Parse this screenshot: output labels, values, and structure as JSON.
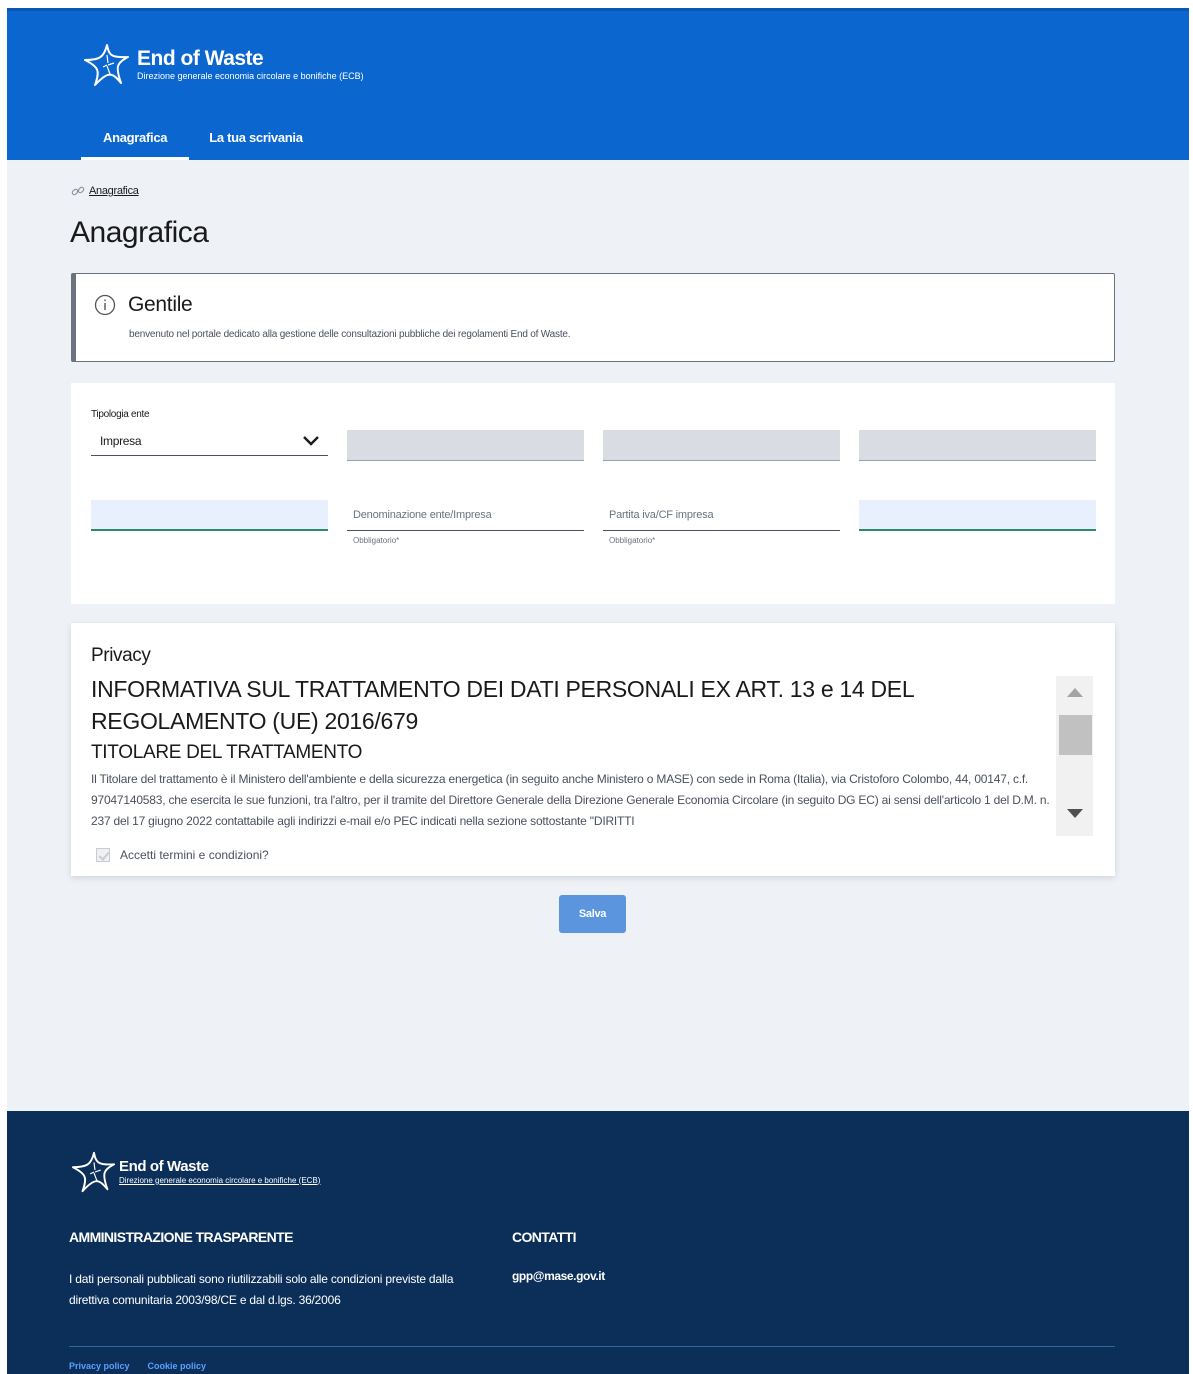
{
  "header": {
    "title": "End of Waste",
    "subtitle": "Direzione generale economia circolare e bonifiche (ECB)",
    "nav": [
      {
        "label": "Anagrafica"
      },
      {
        "label": "La tua scrivania"
      }
    ],
    "color": "#0b66d0"
  },
  "breadcrumb": {
    "icon": "link-icon",
    "label": "Anagrafica"
  },
  "page_title": "Anagrafica",
  "callout": {
    "icon": "info-icon",
    "title": "Gentile",
    "text": "benvenuto nel portale dedicato alla gestione delle consultazioni pubbliche dei regolamenti End of Waste."
  },
  "form": {
    "tipologia": {
      "label": "Tipologia ente",
      "value": "Impresa",
      "icon": "chevron-down-icon"
    },
    "denominazione": {
      "placeholder": "Denominazione ente/Impresa",
      "helper": "Obbligatorio*"
    },
    "partita_iva": {
      "placeholder": "Partita iva/CF impresa",
      "helper": "Obbligatorio*"
    }
  },
  "privacy": {
    "title": "Privacy",
    "heading": "INFORMATIVA SUL TRATTAMENTO DEI DATI PERSONALI EX ART. 13 e 14 DEL REGOLAMENTO (UE) 2016/679",
    "subheading": "TITOLARE DEL TRATTAMENTO",
    "text": "Il Titolare del trattamento è il Ministero dell'ambiente e della sicurezza energetica (in seguito anche Ministero o MASE) con sede in Roma (Italia), via Cristoforo Colombo, 44, 00147, c.f. 97047140583, che esercita le sue funzioni, tra l'altro, per il tramite del Direttore Generale della Direzione Generale Economia Circolare (in seguito DG EC) ai sensi dell'articolo 1 del D.M. n. 237 del 17 giugno 2022 contattabile agli indirizzi e-mail e/o PEC indicati nella sezione sottostante \"DIRITTI",
    "accept_label": "Accetti termini e condizioni?",
    "accept_checked": true
  },
  "save_label": "Salva",
  "footer": {
    "title": "End of Waste",
    "subtitle": "Direzione generale economia circolare e bonifiche (ECB)",
    "col1_title": "AMMINISTRAZIONE TRASPARENTE",
    "col1_text": "I dati personali pubblicati sono riutilizzabili solo alle condizioni previste dalla direttiva comunitaria 2003/98/CE e dal d.lgs. 36/2006",
    "col2_title": "CONTATTI",
    "email": "gpp@mase.gov.it",
    "links": [
      {
        "label": "Privacy policy"
      },
      {
        "label": "Cookie policy"
      }
    ],
    "color": "#0c2f5a"
  }
}
